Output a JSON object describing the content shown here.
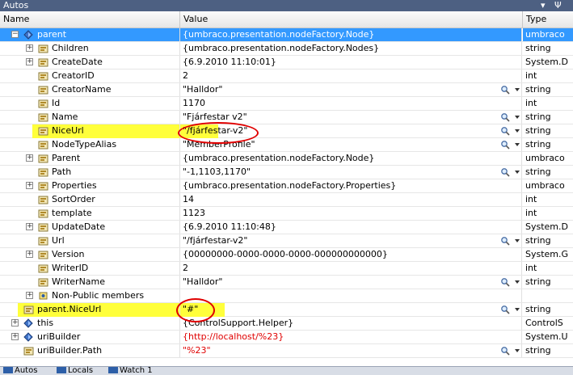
{
  "title": "Autos",
  "title_controls": [
    "▾",
    "Ψ"
  ],
  "columns": {
    "name": "Name",
    "value": "Value",
    "type": "Type"
  },
  "rows": [
    {
      "name": "parent",
      "value": "{umbraco.presentation.nodeFactory.Node}",
      "type": "umbraco",
      "depth": 0,
      "expander": "minus",
      "icon": "object-icon",
      "selected": true
    },
    {
      "name": "Children",
      "value": "{umbraco.presentation.nodeFactory.Nodes}",
      "type": "string",
      "depth": 1,
      "expander": "plus",
      "icon": "property-icon"
    },
    {
      "name": "CreateDate",
      "value": "{6.9.2010 11:10:01}",
      "type": "System.D",
      "depth": 1,
      "expander": "plus",
      "icon": "property-icon"
    },
    {
      "name": "CreatorID",
      "value": "2",
      "type": "int",
      "depth": 1,
      "expander": "none",
      "icon": "property-icon"
    },
    {
      "name": "CreatorName",
      "value": "\"Halldor\"",
      "type": "string",
      "depth": 1,
      "expander": "none",
      "icon": "property-icon",
      "tools": true
    },
    {
      "name": "Id",
      "value": "1170",
      "type": "int",
      "depth": 1,
      "expander": "none",
      "icon": "property-icon"
    },
    {
      "name": "Name",
      "value": "\"Fjárfestar v2\"",
      "type": "string",
      "depth": 1,
      "expander": "none",
      "icon": "property-icon",
      "tools": true
    },
    {
      "name": "NiceUrl",
      "value": "\"/fjárfestar-v2\"",
      "type": "string",
      "depth": 1,
      "expander": "none",
      "icon": "property-icon",
      "tools": true,
      "highlight": true
    },
    {
      "name": "NodeTypeAlias",
      "value": "\"MemberProfile\"",
      "type": "string",
      "depth": 1,
      "expander": "none",
      "icon": "property-icon",
      "tools": true
    },
    {
      "name": "Parent",
      "value": "{umbraco.presentation.nodeFactory.Node}",
      "type": "umbraco",
      "depth": 1,
      "expander": "plus",
      "icon": "property-icon"
    },
    {
      "name": "Path",
      "value": "\"-1,1103,1170\"",
      "type": "string",
      "depth": 1,
      "expander": "none",
      "icon": "property-icon",
      "tools": true
    },
    {
      "name": "Properties",
      "value": "{umbraco.presentation.nodeFactory.Properties}",
      "type": "umbraco",
      "depth": 1,
      "expander": "plus",
      "icon": "property-icon"
    },
    {
      "name": "SortOrder",
      "value": "14",
      "type": "int",
      "depth": 1,
      "expander": "none",
      "icon": "property-icon"
    },
    {
      "name": "template",
      "value": "1123",
      "type": "int",
      "depth": 1,
      "expander": "none",
      "icon": "property-icon"
    },
    {
      "name": "UpdateDate",
      "value": "{6.9.2010 11:10:48}",
      "type": "System.D",
      "depth": 1,
      "expander": "plus",
      "icon": "property-icon"
    },
    {
      "name": "Url",
      "value": "\"/fjárfestar-v2\"",
      "type": "string",
      "depth": 1,
      "expander": "none",
      "icon": "property-icon",
      "tools": true
    },
    {
      "name": "Version",
      "value": "{00000000-0000-0000-0000-000000000000}",
      "type": "System.G",
      "depth": 1,
      "expander": "plus",
      "icon": "property-icon"
    },
    {
      "name": "WriterID",
      "value": "2",
      "type": "int",
      "depth": 1,
      "expander": "none",
      "icon": "property-icon"
    },
    {
      "name": "WriterName",
      "value": "\"Halldor\"",
      "type": "string",
      "depth": 1,
      "expander": "none",
      "icon": "property-icon",
      "tools": true
    },
    {
      "name": "Non-Public members",
      "value": "",
      "type": "",
      "depth": 1,
      "expander": "plus",
      "icon": "members-icon"
    },
    {
      "name": "parent.NiceUrl",
      "value": "\"#\"",
      "type": "string",
      "depth": 0,
      "expander": "none",
      "icon": "property-icon",
      "tools": true,
      "highlight": true
    },
    {
      "name": "this",
      "value": "{ControlSupport.Helper}",
      "type": "ControlS",
      "depth": 0,
      "expander": "plus",
      "icon": "object-icon"
    },
    {
      "name": "uriBuilder",
      "value": "{http://localhost/%23}",
      "type": "System.U",
      "depth": 0,
      "expander": "plus",
      "icon": "object-icon",
      "changed": true
    },
    {
      "name": "uriBuilder.Path",
      "value": "\"%23\"",
      "type": "string",
      "depth": 0,
      "expander": "none",
      "icon": "property-icon",
      "tools": true,
      "changed": true
    }
  ],
  "tabs": [
    {
      "label": "Autos",
      "icon": "autos-tab-icon",
      "active": true
    },
    {
      "label": "Locals",
      "icon": "locals-tab-icon"
    },
    {
      "label": "Watch 1",
      "icon": "watch-tab-icon"
    }
  ],
  "colors": {
    "highlight": "#ffff3b",
    "annotation": "#e00000",
    "changed_value": "#e00000",
    "title_bar": "#4d6082"
  }
}
